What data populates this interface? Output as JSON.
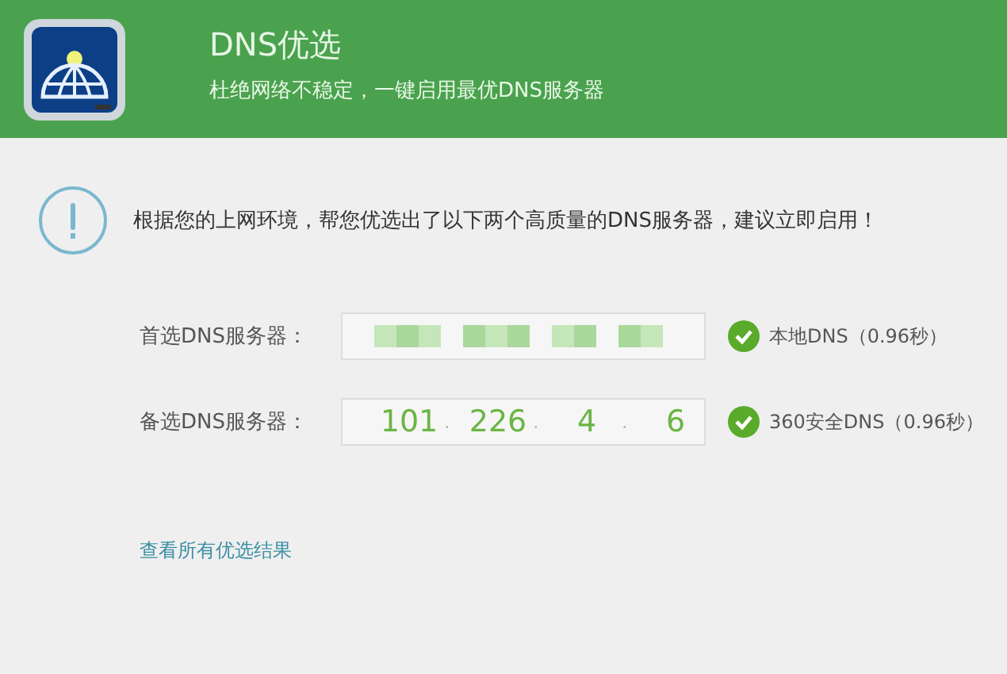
{
  "header": {
    "title": "DNS优选",
    "subtitle": "杜绝网络不稳定，一键启用最优DNS服务器"
  },
  "notice": "根据您的上网环境，帮您优选出了以下两个高质量的DNS服务器，建议立即启用！",
  "servers": [
    {
      "label": "首选DNS服务器：",
      "kind": "masked",
      "status": "本地DNS（0.96秒）"
    },
    {
      "label": "备选DNS服务器：",
      "kind": "address",
      "octets": [
        "101",
        "226",
        "4",
        "6"
      ],
      "separator": ".",
      "status": "360安全DNS（0.96秒）"
    }
  ],
  "link": "查看所有优选结果"
}
